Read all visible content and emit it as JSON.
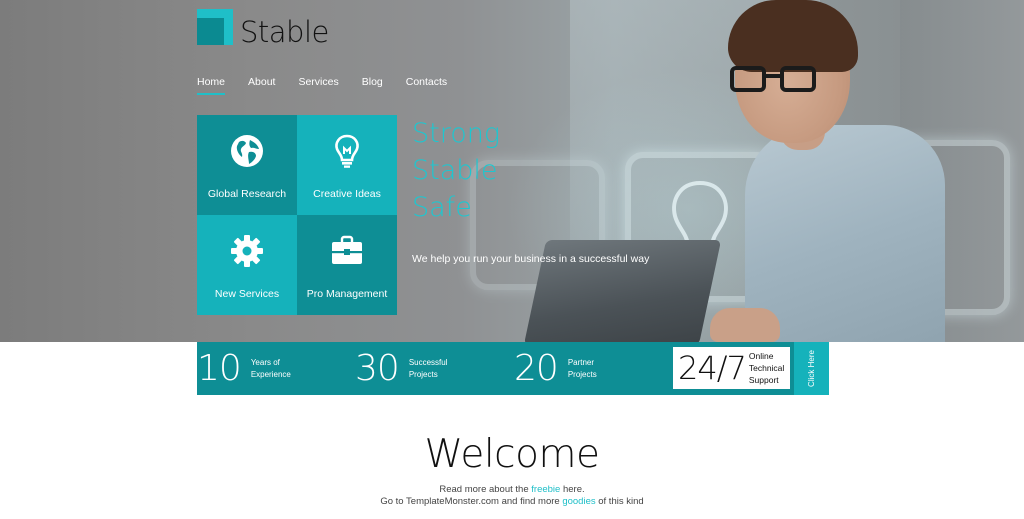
{
  "brand": {
    "name": "Stable",
    "accent_color": "#1fbfc8",
    "dark_color": "#0e8e95"
  },
  "nav": [
    {
      "label": "Home",
      "active": true
    },
    {
      "label": "About",
      "active": false
    },
    {
      "label": "Services",
      "active": false
    },
    {
      "label": "Blog",
      "active": false
    },
    {
      "label": "Contacts",
      "active": false
    }
  ],
  "tiles": [
    {
      "label": "Global Research",
      "icon": "globe-icon"
    },
    {
      "label": "Creative Ideas",
      "icon": "lightbulb-icon"
    },
    {
      "label": "New Services",
      "icon": "gear-icon"
    },
    {
      "label": "Pro Management",
      "icon": "briefcase-icon"
    }
  ],
  "hero": {
    "headline": [
      "Strong",
      "Stable",
      "Safe"
    ],
    "tagline": "We help you run your business in a successful way"
  },
  "stats": [
    {
      "number": "10",
      "label": "Years of\nExperience"
    },
    {
      "number": "30",
      "label": "Successful\nProjects"
    },
    {
      "number": "20",
      "label": "Partner\nProjects"
    }
  ],
  "support": {
    "number": "24/7",
    "label": "Online\nTechnical\nSupport",
    "cta": "Click Here"
  },
  "welcome": {
    "title": "Welcome",
    "line1_pre": "Read more about the ",
    "line1_link": "freebie",
    "line1_post": " here.",
    "line2_pre": "Go to TemplateMonster.com and find more ",
    "line2_link": "goodies",
    "line2_post": " of this kind"
  }
}
